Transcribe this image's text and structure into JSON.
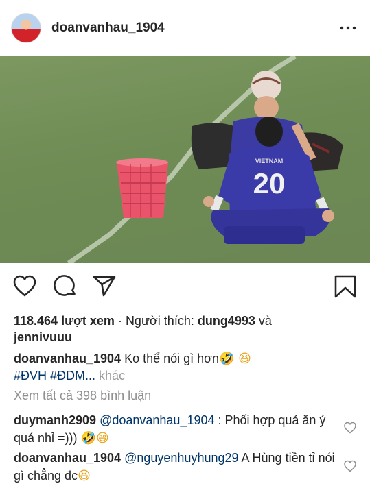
{
  "header": {
    "username": "doanvanhau_1904",
    "avatar_icon": "profile-photo",
    "more_icon": "more-options-icon",
    "more_label": "•••"
  },
  "media": {
    "description_icon": "video-frame",
    "jersey_number": "20",
    "jersey_text": "VIETNAM"
  },
  "actions": {
    "like_icon": "heart-icon",
    "comment_icon": "comment-icon",
    "share_icon": "share-icon",
    "save_icon": "bookmark-icon"
  },
  "stats": {
    "views": "118.464 lượt xem",
    "separator": " · ",
    "liked_by_label": "Người thích: ",
    "liked_by_user": "dung4993",
    "and_label": " và",
    "liked_by_user2": "jennivuuu"
  },
  "caption": {
    "username": "doanvanhau_1904",
    "text": "Ko thể nói gì hơn",
    "emoji": "🤣 😆",
    "hashtags": "#ĐVH #ĐDM...",
    "more_label": "khác"
  },
  "view_all_comments": "Xem tất cả 398 bình luận",
  "comments": [
    {
      "username": "duymanh2909",
      "mention": "@doanvanhau_1904",
      "text": " : Phối hợp quả ăn ý quá nhỉ =)))",
      "emoji": "🤣😄"
    },
    {
      "username": "doanvanhau_1904",
      "mention": "@nguyenhuyhung29",
      "text": " A Hùng tiền tỉ nói gì chẳng đc",
      "emoji": "😆"
    }
  ],
  "colors": {
    "text": "#262626",
    "link": "#003569",
    "muted": "#8e8e8e",
    "pitch": "#728f58",
    "jersey": "#3a3aa8"
  }
}
